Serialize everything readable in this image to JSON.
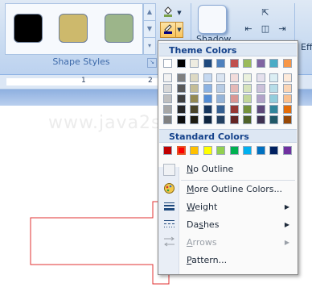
{
  "ribbon": {
    "group_label": "Shape Styles",
    "shadow_label": "Shadow",
    "effects_label": "Eff",
    "style_swatches": [
      {
        "name": "black",
        "color": "#000000"
      },
      {
        "name": "gold",
        "color": "#cdb96c"
      },
      {
        "name": "sage",
        "color": "#9cb58a"
      }
    ],
    "scroll_up": "▲",
    "scroll_down": "▼",
    "scroll_more": "▾"
  },
  "ruler": {
    "marks": [
      "1",
      "2"
    ]
  },
  "watermark": "www.java2s.com",
  "menu": {
    "theme_header": "Theme Colors",
    "standard_header": "Standard Colors",
    "theme_top_row": [
      "#ffffff",
      "#000000",
      "#eeece1",
      "#1f497d",
      "#4f81bd",
      "#c0504d",
      "#9bbb59",
      "#8064a2",
      "#4bacc6",
      "#f79646"
    ],
    "theme_columns": [
      [
        "#f2f2f2",
        "#d9d9d9",
        "#bfbfbf",
        "#a6a6a6",
        "#808080"
      ],
      [
        "#7f7f7f",
        "#595959",
        "#404040",
        "#262626",
        "#0d0d0d"
      ],
      [
        "#ddd9c3",
        "#c4bd97",
        "#938953",
        "#494429",
        "#1d1b10"
      ],
      [
        "#c6d9f0",
        "#8db3e2",
        "#548dd4",
        "#17365d",
        "#0f243e"
      ],
      [
        "#dbe5f1",
        "#b8cce4",
        "#95b3d7",
        "#366092",
        "#244061"
      ],
      [
        "#f2dcdb",
        "#e5b9b7",
        "#d99694",
        "#953734",
        "#632423"
      ],
      [
        "#ebf1dd",
        "#d7e3bc",
        "#c3d69b",
        "#76923c",
        "#4f6128"
      ],
      [
        "#e5e0ec",
        "#ccc1d9",
        "#b2a2c7",
        "#5f497a",
        "#3f3151"
      ],
      [
        "#dbeef3",
        "#b7dde8",
        "#92cddc",
        "#31859b",
        "#205867"
      ],
      [
        "#fdeada",
        "#fbd5b5",
        "#fac08f",
        "#e36c09",
        "#974806"
      ]
    ],
    "standard_colors": [
      "#c00000",
      "#ff0000",
      "#ffc000",
      "#ffff00",
      "#92d050",
      "#00b050",
      "#00b0f0",
      "#0070c0",
      "#002060",
      "#7030a0"
    ],
    "selected_standard_index": 1,
    "items": {
      "no_outline": {
        "pre": "",
        "key": "N",
        "post": "o Outline"
      },
      "more_colors": {
        "pre": "",
        "key": "M",
        "post": "ore Outline Colors..."
      },
      "weight": {
        "pre": "",
        "key": "W",
        "post": "eight"
      },
      "dashes": {
        "pre": "Da",
        "key": "s",
        "post": "hes"
      },
      "arrows": {
        "pre": "",
        "key": "A",
        "post": "rrows"
      },
      "pattern": {
        "pre": "",
        "key": "P",
        "post": "attern..."
      }
    },
    "submenu_arrow": "▶"
  },
  "colors": {
    "shape_outline": "#e03030",
    "accent_highlight": "#f9c55b"
  }
}
